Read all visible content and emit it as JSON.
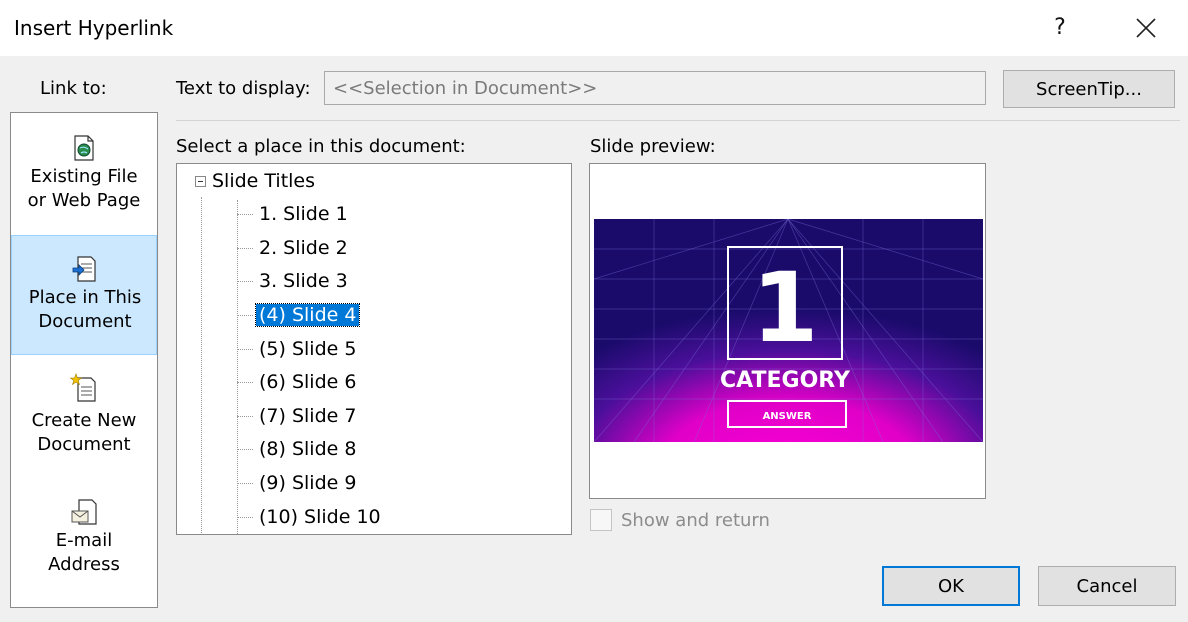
{
  "window": {
    "title": "Insert Hyperlink",
    "help_glyph": "?",
    "close_icon": "close-icon"
  },
  "link_to": {
    "label": "Link to:",
    "items": [
      {
        "label_line1": "Existing File",
        "label_line2": "or Web Page",
        "icon": "web-page-icon",
        "selected": false
      },
      {
        "label_line1": "Place in This",
        "label_line2": "Document",
        "icon": "document-place-icon",
        "selected": true
      },
      {
        "label_line1": "Create New",
        "label_line2": "Document",
        "icon": "new-document-icon",
        "selected": false
      },
      {
        "label_line1": "E-mail",
        "label_line2": "Address",
        "icon": "email-icon",
        "selected": false
      }
    ]
  },
  "text_to_display": {
    "label": "Text to display:",
    "value": "<<Selection in Document>>"
  },
  "screentip_button": "ScreenTip...",
  "place_list": {
    "label": "Select a place in this document:",
    "root": "Slide Titles",
    "items": [
      "1. Slide 1",
      "2. Slide 2",
      "3. Slide 3",
      "(4) Slide 4",
      "(5) Slide 5",
      "(6) Slide 6",
      "(7) Slide 7",
      "(8) Slide 8",
      "(9) Slide 9",
      "(10) Slide 10"
    ],
    "selected_index": 3
  },
  "preview": {
    "label": "Slide preview:",
    "slide_number": "1",
    "slide_title": "CATEGORY",
    "slide_button": "ANSWER"
  },
  "show_and_return": {
    "label": "Show and return",
    "checked": false
  },
  "buttons": {
    "ok": "OK",
    "cancel": "Cancel"
  },
  "colors": {
    "selection": "#0078d7",
    "sidebar_selected": "#cce8ff",
    "slide_bg": "#1a0b6b",
    "slide_glow": "#ff00d4"
  }
}
